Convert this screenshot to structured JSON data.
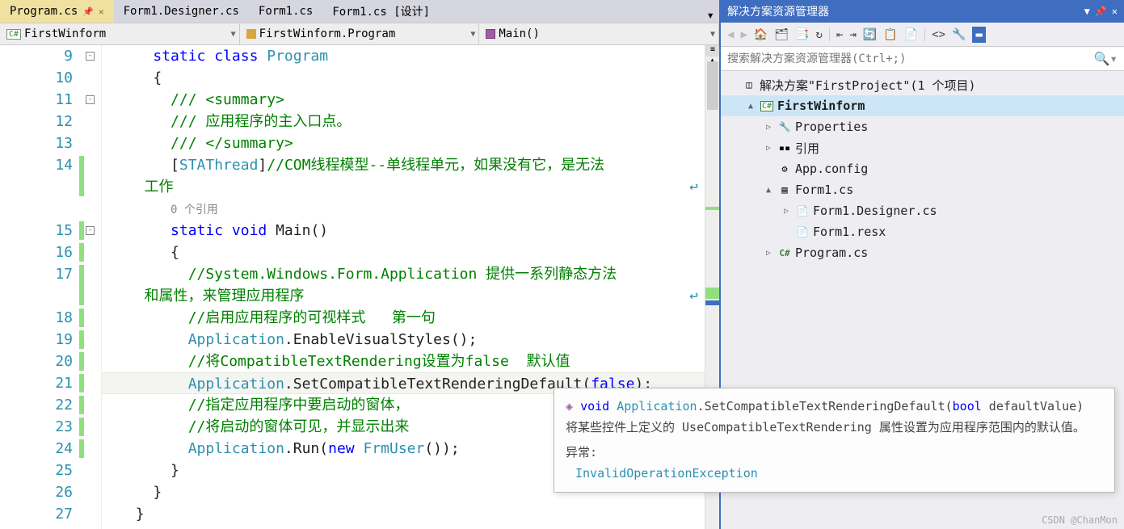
{
  "tabs": {
    "active": "Program.cs",
    "items": [
      "Program.cs",
      "Form1.Designer.cs",
      "Form1.cs",
      "Form1.cs [设计]"
    ]
  },
  "breadcrumbs": {
    "namespace": "FirstWinform",
    "class": "FirstWinform.Program",
    "method": "Main()"
  },
  "code": {
    "lines": [
      {
        "num": 9,
        "fold": true,
        "mark": false,
        "segments": [
          {
            "t": "kw",
            "v": "static class "
          },
          {
            "t": "type",
            "v": "Program"
          }
        ],
        "indent": 2
      },
      {
        "num": 10,
        "mark": false,
        "segments": [
          {
            "t": "txt",
            "v": "{"
          }
        ],
        "indent": 2
      },
      {
        "num": 11,
        "fold": true,
        "mark": false,
        "segments": [
          {
            "t": "cmt",
            "v": "/// <summary>"
          }
        ],
        "indent": 3
      },
      {
        "num": 12,
        "mark": false,
        "segments": [
          {
            "t": "cmt",
            "v": "/// 应用程序的主入口点。"
          }
        ],
        "indent": 3
      },
      {
        "num": 13,
        "mark": false,
        "segments": [
          {
            "t": "cmt",
            "v": "/// </summary>"
          }
        ],
        "indent": 3
      },
      {
        "num": 14,
        "mark": true,
        "tall": true,
        "segments": [
          {
            "t": "txt",
            "v": "["
          },
          {
            "t": "type",
            "v": "STAThread"
          },
          {
            "t": "txt",
            "v": "]"
          },
          {
            "t": "cmt",
            "v": "//COM线程模型--单线程单元，如果没有它，是无法\n   工作"
          }
        ],
        "indent": 3,
        "wrap": true
      },
      {
        "num": "",
        "ref": true,
        "segments": [
          {
            "t": "ref",
            "v": "0 个引用"
          }
        ],
        "indent": 3
      },
      {
        "num": 15,
        "fold": true,
        "mark": true,
        "segments": [
          {
            "t": "kw",
            "v": "static void "
          },
          {
            "t": "meth",
            "v": "Main"
          },
          {
            "t": "txt",
            "v": "()"
          }
        ],
        "indent": 3
      },
      {
        "num": 16,
        "mark": true,
        "segments": [
          {
            "t": "txt",
            "v": "{"
          }
        ],
        "indent": 3
      },
      {
        "num": 17,
        "mark": true,
        "tall": true,
        "segments": [
          {
            "t": "cmt",
            "v": "//System.Windows.Form.Application 提供一系列静态方法\n   和属性，来管理应用程序"
          }
        ],
        "indent": 4,
        "wrap": true
      },
      {
        "num": 18,
        "mark": true,
        "segments": [
          {
            "t": "cmt",
            "v": "//启用应用程序的可视样式   第一句"
          }
        ],
        "indent": 4
      },
      {
        "num": 19,
        "mark": true,
        "segments": [
          {
            "t": "type",
            "v": "Application"
          },
          {
            "t": "txt",
            "v": ".EnableVisualStyles();"
          }
        ],
        "indent": 4
      },
      {
        "num": 20,
        "mark": true,
        "segments": [
          {
            "t": "cmt",
            "v": "//将CompatibleTextRendering设置为false  默认值"
          }
        ],
        "indent": 4
      },
      {
        "num": 21,
        "mark": true,
        "hl": true,
        "segments": [
          {
            "t": "type",
            "v": "Application"
          },
          {
            "t": "txt",
            "v": ".SetCompatibleTextRenderingDefault("
          },
          {
            "t": "kw",
            "v": "false"
          },
          {
            "t": "txt",
            "v": ");"
          }
        ],
        "indent": 4
      },
      {
        "num": 22,
        "mark": true,
        "segments": [
          {
            "t": "cmt",
            "v": "//指定应用程序中要启动的窗体，"
          }
        ],
        "indent": 4
      },
      {
        "num": 23,
        "mark": true,
        "segments": [
          {
            "t": "cmt",
            "v": "//将启动的窗体可见，并显示出来"
          }
        ],
        "indent": 4
      },
      {
        "num": 24,
        "mark": true,
        "segments": [
          {
            "t": "type",
            "v": "Application"
          },
          {
            "t": "txt",
            "v": ".Run("
          },
          {
            "t": "kw",
            "v": "new "
          },
          {
            "t": "type",
            "v": "FrmUser"
          },
          {
            "t": "txt",
            "v": "());"
          }
        ],
        "indent": 4
      },
      {
        "num": 25,
        "mark": false,
        "segments": [
          {
            "t": "txt",
            "v": "}"
          }
        ],
        "indent": 3
      },
      {
        "num": 26,
        "mark": false,
        "segments": [
          {
            "t": "txt",
            "v": "}"
          }
        ],
        "indent": 2
      },
      {
        "num": 27,
        "mark": false,
        "segments": [
          {
            "t": "txt",
            "v": "}"
          }
        ],
        "indent": 1
      }
    ]
  },
  "tooltip": {
    "return": "void",
    "class": "Application",
    "method": ".SetCompatibleTextRenderingDefault(",
    "paramtype": "bool",
    "paramname": " defaultValue)",
    "desc": "将某些控件上定义的 UseCompatibleTextRendering 属性设置为应用程序范围内的默认值。",
    "exc_label": "异常:",
    "exc_name": "InvalidOperationException"
  },
  "explorer": {
    "title": "解决方案资源管理器",
    "search_placeholder": "搜索解决方案资源管理器(Ctrl+;)",
    "tree": [
      {
        "depth": 0,
        "arrow": "",
        "icon": "sln",
        "label": "解决方案\"FirstProject\"(1 个项目)"
      },
      {
        "depth": 1,
        "arrow": "▲",
        "icon": "cs",
        "label": "FirstWinform",
        "bold": true,
        "selected": true
      },
      {
        "depth": 2,
        "arrow": "▷",
        "icon": "wrench",
        "label": "Properties"
      },
      {
        "depth": 2,
        "arrow": "▷",
        "icon": "ref",
        "label": "引用"
      },
      {
        "depth": 2,
        "arrow": "",
        "icon": "cfg",
        "label": "App.config"
      },
      {
        "depth": 2,
        "arrow": "▲",
        "icon": "form",
        "label": "Form1.cs"
      },
      {
        "depth": 3,
        "arrow": "▷",
        "icon": "file",
        "label": "Form1.Designer.cs"
      },
      {
        "depth": 3,
        "arrow": "",
        "icon": "file",
        "label": "Form1.resx"
      },
      {
        "depth": 2,
        "arrow": "▷",
        "icon": "cs2",
        "label": "Program.cs"
      }
    ]
  },
  "watermark": "CSDN @ChanMon"
}
